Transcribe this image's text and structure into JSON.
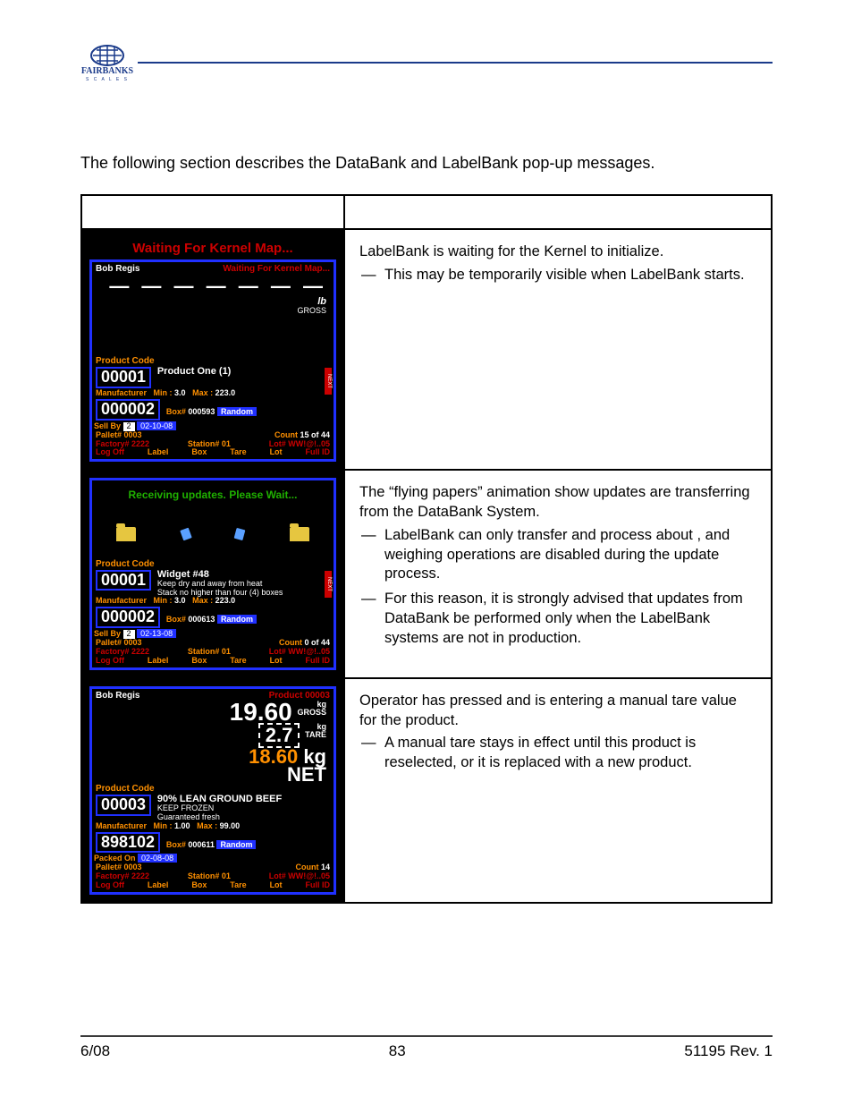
{
  "logo_text": "FAIRBANKS",
  "intro": "The following section describes the DataBank and LabelBank pop-up messages.",
  "rows": [
    {
      "callout": "Waiting For Kernel Map...",
      "screen": {
        "user": "Bob Regis",
        "status": "Waiting For Kernel Map...",
        "weight_display": "— — — — — — —",
        "unit_top": "lb",
        "unit_bottom": "GROSS",
        "product_code_label": "Product Code",
        "product_code": "00001",
        "product_name": "Product One (1)",
        "mfr_label": "Manufacturer",
        "mfr_code": "000002",
        "min_label": "Min :",
        "min": "3.0",
        "max_label": "Max :",
        "max": "223.0",
        "box_label": "Box#",
        "box": "000593",
        "random": "Random",
        "sellby_label": "Sell By",
        "sellby_n": "2",
        "sellby_date": "02-10-08",
        "pallet": "Pallet# 0003",
        "count_label": "Count",
        "count": "15 of 44",
        "factory": "Factory# 2222",
        "station": "Station# 01",
        "lot": "Lot# WW!@!..05",
        "menu": [
          "Log Off",
          "Label",
          "Box",
          "Tare",
          "Lot",
          "Full ID"
        ]
      },
      "desc_lead": "LabelBank is waiting for the Kernel to initialize.",
      "desc_items": [
        "This may be temporarily visible when LabelBank starts."
      ]
    },
    {
      "green_msg": "Receiving updates. Please Wait...",
      "screen": {
        "product_code_label": "Product Code",
        "product_code": "00001",
        "product_name": "Widget #48",
        "product_sub1": "Keep dry and away from heat",
        "product_sub2": "Stack no higher than four (4) boxes",
        "mfr_label": "Manufacturer",
        "mfr_code": "000002",
        "min_label": "Min :",
        "min": "3.0",
        "max_label": "Max :",
        "max": "223.0",
        "box_label": "Box#",
        "box": "000613",
        "random": "Random",
        "sellby_label": "Sell By",
        "sellby_n": "2",
        "sellby_date": "02-13-08",
        "pallet": "Pallet# 0003",
        "count_label": "Count",
        "count": "0 of 44",
        "factory": "Factory# 2222",
        "station": "Station# 01",
        "lot": "Lot# WW!@!..05",
        "menu": [
          "Log Off",
          "Label",
          "Box",
          "Tare",
          "Lot",
          "Full ID"
        ]
      },
      "desc_lead": "The “flying papers” animation show updates are transferring from the DataBank System.",
      "desc_items": [
        "LabelBank can only transfer and process about , and weighing operations are disabled during the update process.",
        "For this reason, it is strongly advised that updates from DataBank be performed only when the LabelBank systems are not in production."
      ]
    },
    {
      "screen": {
        "user": "Bob Regis",
        "status": "Product 00003",
        "gross": "19.60",
        "gross_unit": "kg",
        "gross_lbl": "GROSS",
        "tare": "2.7",
        "tare_unit": "kg",
        "tare_lbl": "TARE",
        "net": "18.60",
        "net_unit": "kg",
        "net_lbl": "NET",
        "product_code_label": "Product Code",
        "product_code": "00003",
        "product_name": "90% LEAN GROUND BEEF",
        "product_sub1": "KEEP FROZEN",
        "product_sub2": "Guaranteed fresh",
        "mfr_label": "Manufacturer",
        "mfr_code": "898102",
        "min_label": "Min :",
        "min": "1.00",
        "max_label": "Max :",
        "max": "99.00",
        "box_label": "Box#",
        "box": "000611",
        "random": "Random",
        "packed_label": "Packed On",
        "packed_date": "02-08-08",
        "pallet": "Pallet# 0003",
        "count_label": "Count",
        "count": "14",
        "factory": "Factory# 2222",
        "station": "Station# 01",
        "lot": "Lot# WW!@!..05",
        "menu": [
          "Log Off",
          "Label",
          "Box",
          "Tare",
          "Lot",
          "Full ID"
        ]
      },
      "desc_lead": "Operator has pressed         and is entering a manual tare value for the product.",
      "desc_items": [
        "A manual tare stays in effect until this product is reselected, or it is replaced with a new product."
      ]
    }
  ],
  "footer": {
    "left": "6/08",
    "center": "83",
    "right": "51195    Rev. 1"
  }
}
